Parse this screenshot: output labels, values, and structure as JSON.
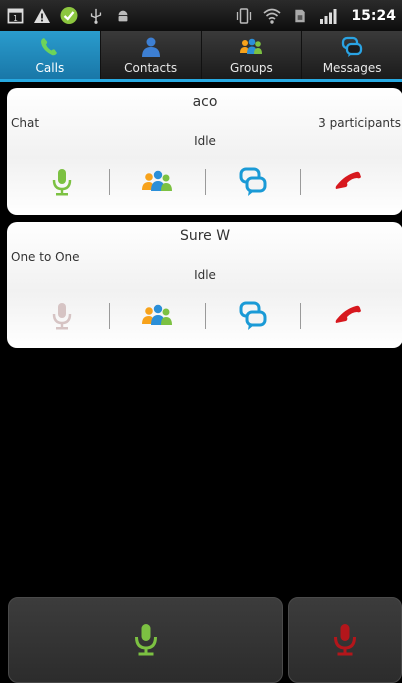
{
  "status_bar": {
    "time": "15:24",
    "left_icons": [
      "calendar-icon",
      "warning-icon",
      "check-icon",
      "usb-icon",
      "android-debug-icon"
    ],
    "right_icons": [
      "vibrate-icon",
      "wifi-icon",
      "sim-icon",
      "signal-icon"
    ]
  },
  "tabs": [
    {
      "label": "Calls",
      "icon": "phone-icon",
      "active": true
    },
    {
      "label": "Contacts",
      "icon": "person-icon",
      "active": false
    },
    {
      "label": "Groups",
      "icon": "group-icon",
      "active": false
    },
    {
      "label": "Messages",
      "icon": "chat-icon",
      "active": false
    }
  ],
  "calls": [
    {
      "name": "aco",
      "type": "Chat",
      "participants": "3 participants",
      "status": "Idle"
    },
    {
      "name": "Sure W",
      "type": "One to One",
      "participants": "",
      "status": "Idle"
    }
  ],
  "colors": {
    "accent": "#27a9e1",
    "mic_active": "#7cc142",
    "mic_disabled": "#d6c4c4",
    "hangup": "#d7181e",
    "chat_blue": "#1a9ad6",
    "group_orange": "#f7a21b"
  }
}
